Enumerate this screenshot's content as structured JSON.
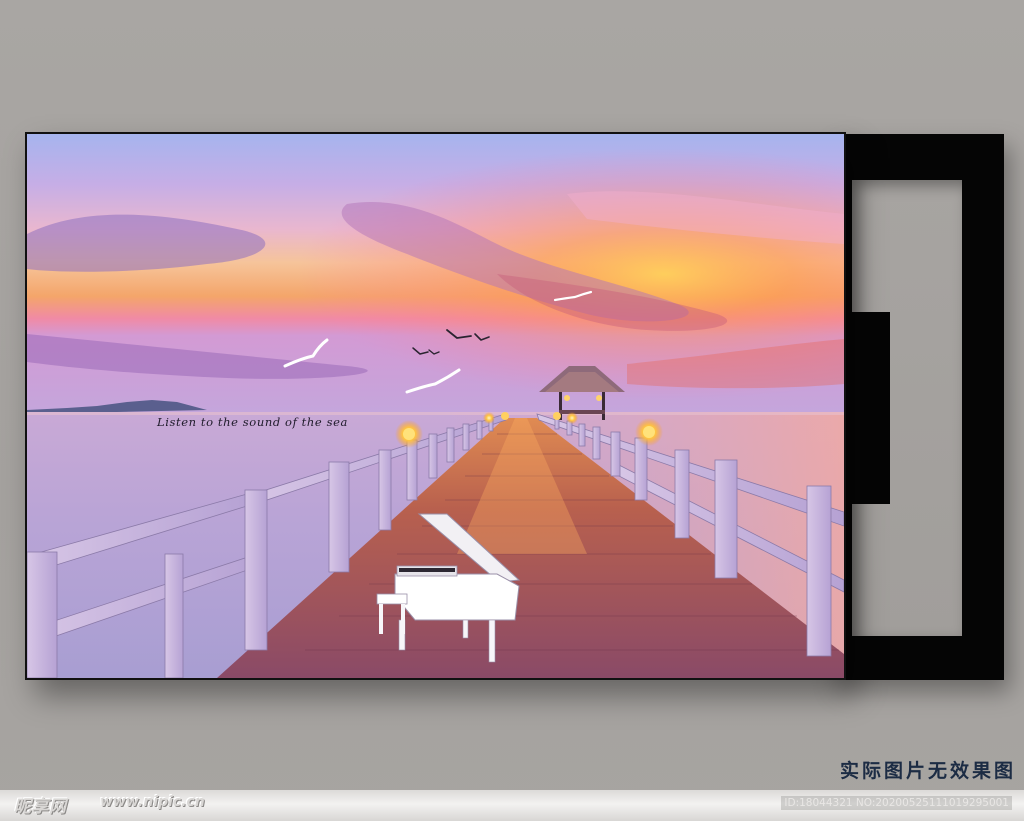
{
  "artwork": {
    "caption": "Listen to the sound of the sea"
  },
  "tagline": "实际图片无效果图",
  "watermark": {
    "logo": "昵享网",
    "url": "www.nipic.cn",
    "image_id": "ID:18044321 NO:20200525111019295001"
  }
}
